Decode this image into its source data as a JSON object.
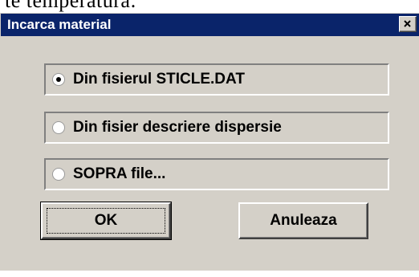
{
  "background_text": "te temperatura:",
  "window": {
    "title": "Incarca material",
    "close_label": "×"
  },
  "options": [
    {
      "label": "Din fisierul STICLE.DAT",
      "selected": true
    },
    {
      "label": "Din fisier descriere dispersie",
      "selected": false
    },
    {
      "label": "SOPRA file...",
      "selected": false
    }
  ],
  "buttons": {
    "ok_label": "OK",
    "cancel_label": "Anuleaza"
  },
  "colors": {
    "titlebar": "#0a246a",
    "dialog_face": "#d4d0c8"
  }
}
